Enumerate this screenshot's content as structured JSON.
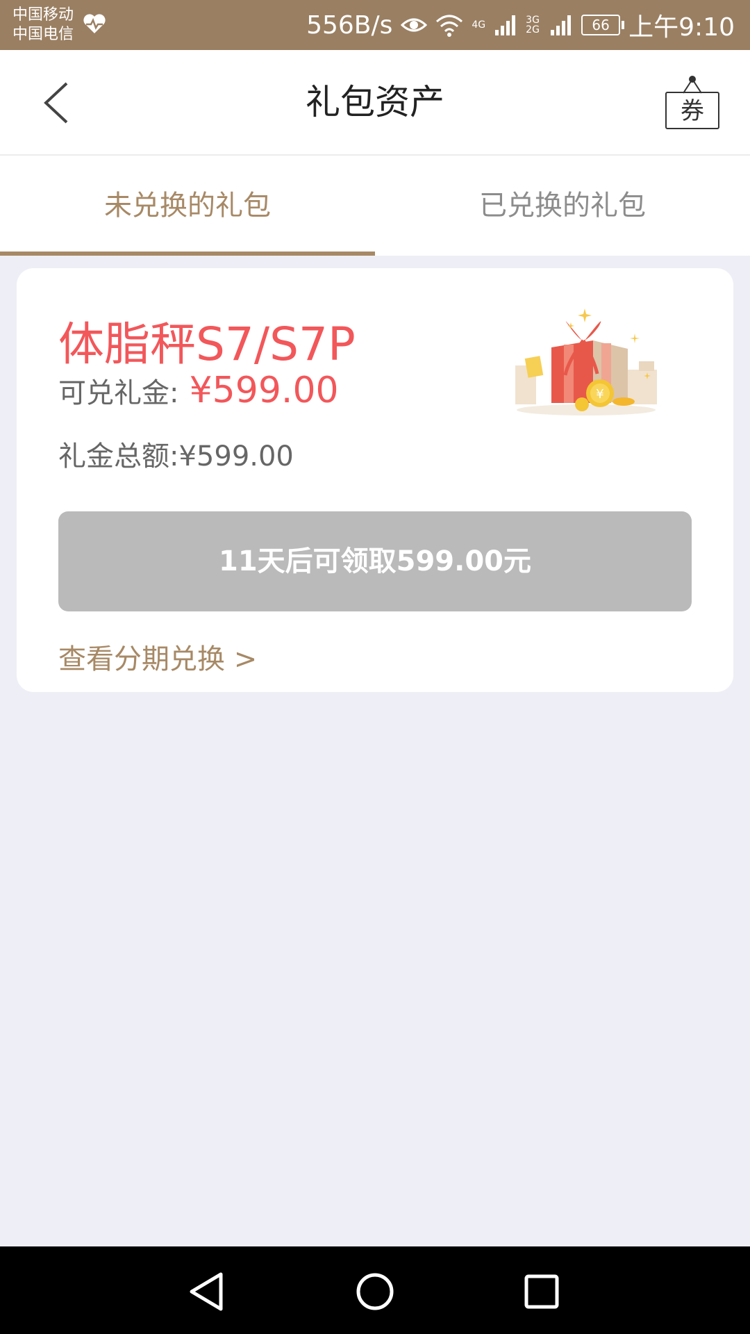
{
  "status_bar": {
    "carrier_1": "中国移动",
    "carrier_2": "中国电信",
    "net_speed": "556B/s",
    "network_1": "4G",
    "network_2": "3G 2G",
    "battery": "66",
    "time": "上午9:10"
  },
  "header": {
    "title": "礼包资产",
    "coupon_label": "券"
  },
  "tabs": [
    {
      "label": "未兑换的礼包",
      "active": true
    },
    {
      "label": "已兑换的礼包",
      "active": false
    }
  ],
  "card": {
    "product_name": "体脂秤S7/S7P",
    "available_label": "可兑礼金:",
    "available_value": "¥599.00",
    "total_text": "礼金总额:¥599.00",
    "claim_button": "11天后可领取599.00元",
    "installment_link": "查看分期兑换 >"
  },
  "colors": {
    "accent": "#a78966",
    "status_bar": "#9a7f62",
    "price_red": "#f2575a",
    "disabled_button": "#bababa",
    "page_background": "#eeeef6"
  },
  "icons": {
    "back": "back-arrow-icon",
    "coupon": "coupon-tag-icon",
    "gift": "gift-box-illustration",
    "nav_back": "triangle-back-icon",
    "nav_home": "circle-home-icon",
    "nav_recent": "square-recent-icon"
  }
}
